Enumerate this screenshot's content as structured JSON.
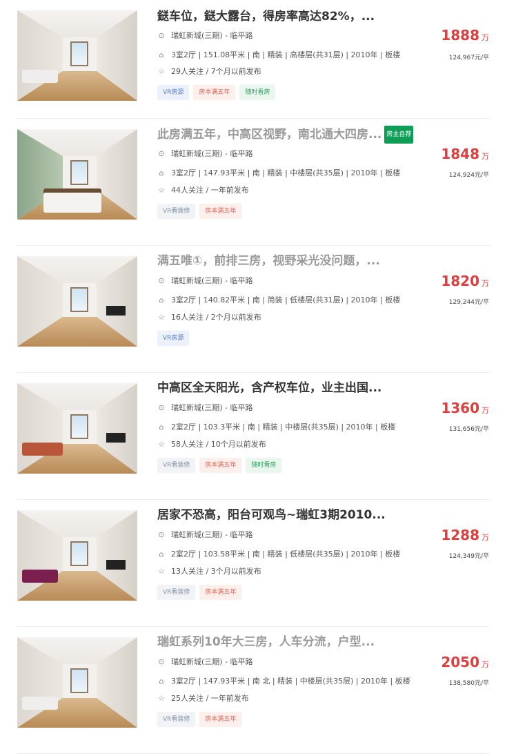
{
  "listings": [
    {
      "title": "鎹车位，鎹大露台，得房率高达82%，...",
      "owner_badge": "",
      "location": "瑞虹新城(三期) - 临平路",
      "info": "3室2厅 | 151.08平米 | 南 | 精装 | 高楼层(共31层) | 2010年 | 板楼",
      "follow": "29人关注 / 7个月以前发布",
      "tags": [
        {
          "text": "VR房源",
          "style": "blue"
        },
        {
          "text": "房本满五年",
          "style": "red"
        },
        {
          "text": "随时看房",
          "style": "green"
        }
      ],
      "total_price": "1888",
      "price_unit": "万",
      "unit_price": "124,967元/平"
    },
    {
      "title": "此房满五年，中高区视野，南北通大四房...",
      "owner_badge": "房主自荐",
      "location": "瑞虹新城(三期) - 临平路",
      "info": "3室2厅 | 147.93平米 | 南 | 精装 | 中楼层(共35层) | 2010年 | 板楼",
      "follow": "44人关注 / 一年前发布",
      "tags": [
        {
          "text": "VR看装修",
          "style": "grey"
        },
        {
          "text": "房本满五年",
          "style": "red"
        }
      ],
      "total_price": "1848",
      "price_unit": "万",
      "unit_price": "124,924元/平"
    },
    {
      "title": "满五唯①，前排三房，视野采光没问题，...",
      "owner_badge": "",
      "location": "瑞虹新城(三期) - 临平路",
      "info": "3室2厅 | 140.82平米 | 南 | 简装 | 低楼层(共31层) | 2010年 | 板楼",
      "follow": "16人关注 / 2个月以前发布",
      "tags": [
        {
          "text": "VR房源",
          "style": "blue"
        }
      ],
      "total_price": "1820",
      "price_unit": "万",
      "unit_price": "129,244元/平"
    },
    {
      "title": "中高区全天阳光，含产权车位，业主出国...",
      "owner_badge": "",
      "location": "瑞虹新城(三期) - 临平路",
      "info": "2室2厅 | 103.3平米 | 南 | 精装 | 中楼层(共35层) | 2010年 | 板楼",
      "follow": "58人关注 / 10个月以前发布",
      "tags": [
        {
          "text": "VR看装修",
          "style": "grey"
        },
        {
          "text": "房本满五年",
          "style": "red"
        },
        {
          "text": "随时看房",
          "style": "green"
        }
      ],
      "total_price": "1360",
      "price_unit": "万",
      "unit_price": "131,656元/平"
    },
    {
      "title": "居家不恐高，阳台可观鸟~瑞虹3期2010...",
      "owner_badge": "",
      "location": "瑞虹新城(三期) - 临平路",
      "info": "2室2厅 | 103.58平米 | 南 | 精装 | 低楼层(共35层) | 2010年 | 板楼",
      "follow": "13人关注 / 3个月以前发布",
      "tags": [
        {
          "text": "VR看装修",
          "style": "grey"
        },
        {
          "text": "房本满五年",
          "style": "red"
        }
      ],
      "total_price": "1288",
      "price_unit": "万",
      "unit_price": "124,349元/平"
    },
    {
      "title": "瑞虹系列10年大三房，人车分流，户型...",
      "owner_badge": "",
      "location": "瑞虹新城(三期) - 临平路",
      "info": "3室2厅 | 147.93平米 | 南 北 | 精装 | 中楼层(共35层) | 2010年 | 板楼",
      "follow": "25人关注 / 一年前发布",
      "tags": [
        {
          "text": "VR看装修",
          "style": "grey"
        },
        {
          "text": "房本满五年",
          "style": "red"
        }
      ],
      "total_price": "2050",
      "price_unit": "万",
      "unit_price": "138,580元/平"
    }
  ],
  "icons": {
    "location": "location-pin-icon",
    "house": "house-icon",
    "star": "star-icon"
  },
  "colors": {
    "price": "#e03d3d",
    "owner_badge": "#0f9d58"
  }
}
